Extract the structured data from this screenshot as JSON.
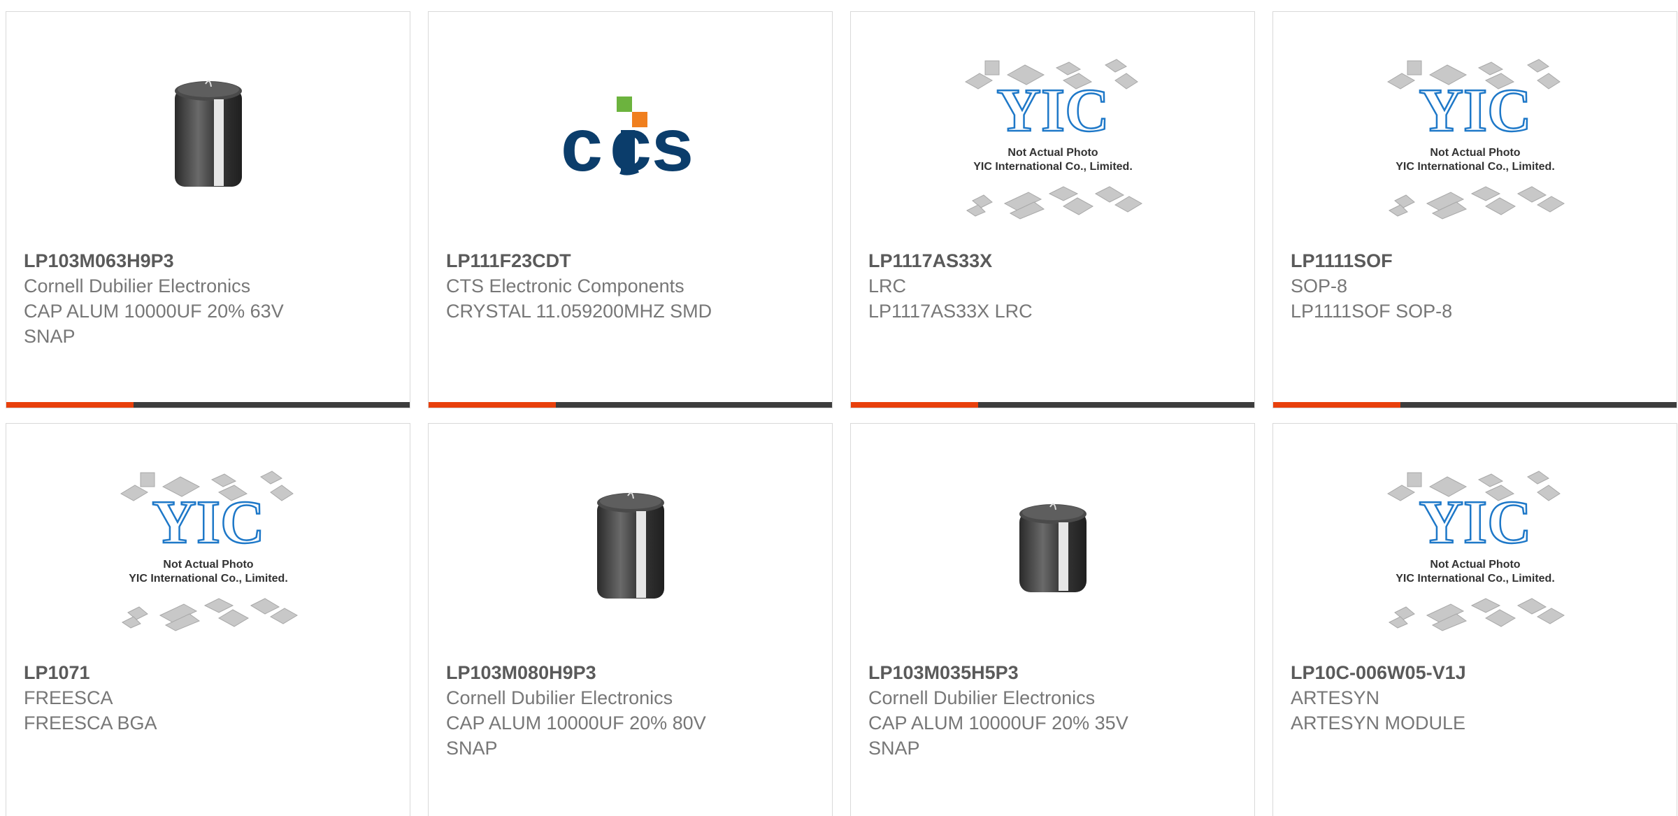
{
  "products": [
    {
      "part": "LP103M063H9P3",
      "maker": "Cornell Dubilier Electronics",
      "desc": "CAP ALUM 10000UF 20% 63V",
      "desc2": "SNAP",
      "image": "capacitor"
    },
    {
      "part": "LP111F23CDT",
      "maker": "CTS Electronic Components",
      "desc": "CRYSTAL 11.059200MHZ SMD",
      "desc2": "",
      "image": "cts-logo"
    },
    {
      "part": "LP1117AS33X",
      "maker": "LRC",
      "desc": "LP1117AS33X LRC",
      "desc2": "",
      "image": "yic-placeholder"
    },
    {
      "part": "LP1111SOF",
      "maker": "SOP-8",
      "desc": "LP1111SOF SOP-8",
      "desc2": "",
      "image": "yic-placeholder"
    },
    {
      "part": "LP1071",
      "maker": "FREESCA",
      "desc": "FREESCA BGA",
      "desc2": "",
      "image": "yic-placeholder"
    },
    {
      "part": "LP103M080H9P3",
      "maker": "Cornell Dubilier Electronics",
      "desc": "CAP ALUM 10000UF 20% 80V",
      "desc2": "SNAP",
      "image": "capacitor"
    },
    {
      "part": "LP103M035H5P3",
      "maker": "Cornell Dubilier Electronics",
      "desc": "CAP ALUM 10000UF 20% 35V",
      "desc2": "SNAP",
      "image": "capacitor"
    },
    {
      "part": "LP10C-006W05-V1J",
      "maker": "ARTESYN",
      "desc": "ARTESYN MODULE",
      "desc2": "",
      "image": "yic-placeholder"
    }
  ],
  "placeholder": {
    "line1": "Not Actual Photo",
    "line2": "YIC International Co., Limited."
  },
  "colors": {
    "accent": "#e8400c",
    "bar": "#3d3d3d",
    "cts_blue": "#0b3d6b",
    "yic_blue": "#1e78c8"
  }
}
